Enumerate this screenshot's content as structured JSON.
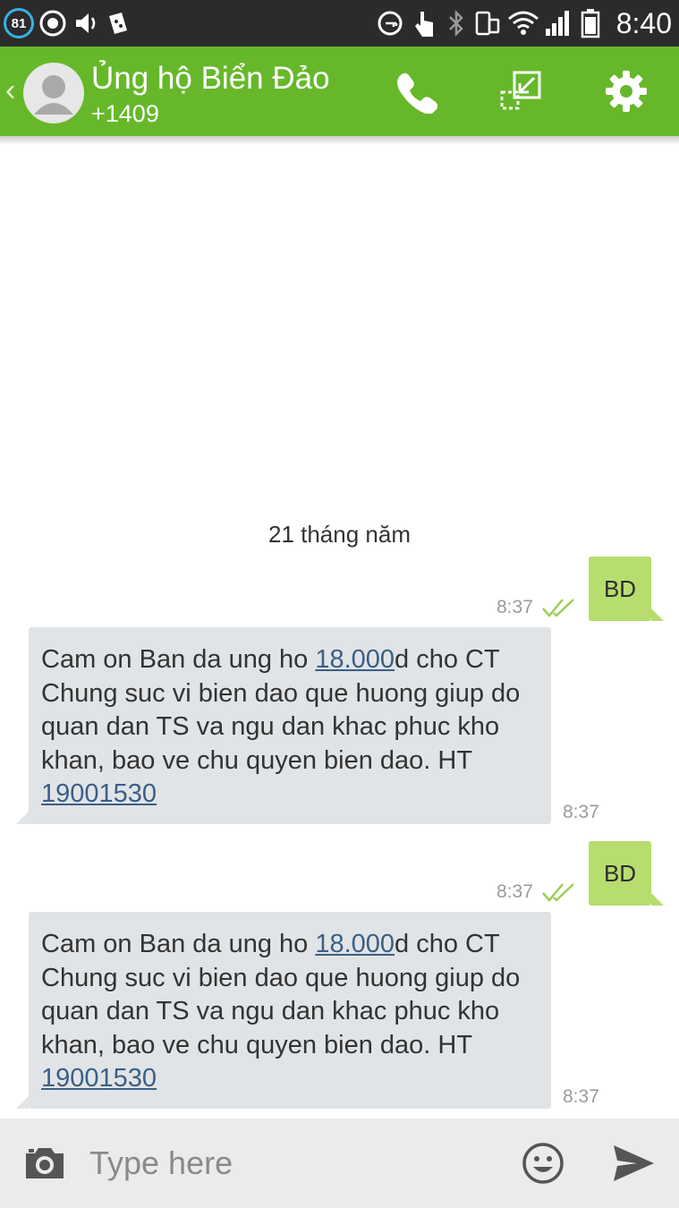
{
  "status_bar": {
    "battery_badge": "81",
    "time": "8:40"
  },
  "header": {
    "back_glyph": "‹",
    "contact_name": "Ủng hộ Biển Đảo",
    "contact_number": "+1409",
    "actions": [
      "phone-icon",
      "minimize-window-icon",
      "gear-icon"
    ],
    "accent_color": "#66b82a"
  },
  "conversation": {
    "date_separator": "21 tháng năm",
    "messages": [
      {
        "direction": "outgoing",
        "text": "BD",
        "time": "8:37",
        "status": "delivered"
      },
      {
        "direction": "incoming",
        "segments": [
          {
            "text": "Cam on Ban da ung ho ",
            "link": false
          },
          {
            "text": "18.000",
            "link": true
          },
          {
            "text": "d cho CT Chung suc vi bien dao que huong giup do quan dan TS va ngu dan khac phuc kho khan, bao ve chu quyen bien dao. HT ",
            "link": false
          },
          {
            "text": "19001530",
            "link": true
          }
        ],
        "time": "8:37"
      },
      {
        "direction": "outgoing",
        "text": "BD",
        "time": "8:37",
        "status": "delivered"
      },
      {
        "direction": "incoming",
        "segments": [
          {
            "text": "Cam on Ban da ung ho ",
            "link": false
          },
          {
            "text": "18.000",
            "link": true
          },
          {
            "text": "d cho CT Chung suc vi bien dao que huong giup do quan dan TS va ngu dan khac phuc kho khan, bao ve chu quyen bien dao. HT ",
            "link": false
          },
          {
            "text": "19001530",
            "link": true
          }
        ],
        "time": "8:37"
      }
    ]
  },
  "composer": {
    "placeholder": "Type here",
    "value": "",
    "icons": [
      "camera-icon",
      "emoji-icon",
      "send-icon"
    ]
  },
  "colors": {
    "outgoing_bubble": "#b6dd6e",
    "incoming_bubble": "#e1e4e6",
    "link": "#3a5f88",
    "check": "#9ccf55"
  }
}
